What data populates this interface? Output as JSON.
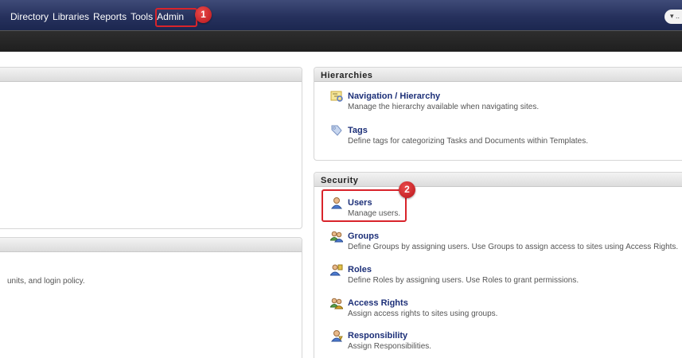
{
  "nav": {
    "items": [
      "Directory",
      "Libraries",
      "Reports",
      "Tools",
      "Admin"
    ],
    "search_label": "▾ .."
  },
  "callouts": {
    "one": "1",
    "two": "2"
  },
  "left_panel": {
    "text": "units, and login policy."
  },
  "hierarchies": {
    "title": "Hierarchies",
    "items": [
      {
        "title": "Navigation / Hierarchy",
        "desc": "Manage the hierarchy available when navigating sites.",
        "icon": "hierarchy-icon"
      },
      {
        "title": "Tags",
        "desc": "Define tags for categorizing Tasks and Documents within Templates.",
        "icon": "tag-icon"
      }
    ]
  },
  "security": {
    "title": "Security",
    "items": [
      {
        "title": "Users",
        "desc": "Manage users.",
        "icon": "user-icon"
      },
      {
        "title": "Groups",
        "desc": "Define Groups by assigning users. Use Groups to assign access to sites using Access Rights.",
        "icon": "group-icon"
      },
      {
        "title": "Roles",
        "desc": "Define Roles by assigning users. Use Roles to grant permissions.",
        "icon": "roles-icon"
      },
      {
        "title": "Access Rights",
        "desc": "Assign access rights to sites using groups.",
        "icon": "access-rights-icon"
      },
      {
        "title": "Responsibility",
        "desc": "Assign Responsibilities.",
        "icon": "responsibility-icon"
      }
    ]
  },
  "colors": {
    "nav_bg": "#26315d",
    "link": "#1c2f78",
    "callout": "#d9242b"
  }
}
